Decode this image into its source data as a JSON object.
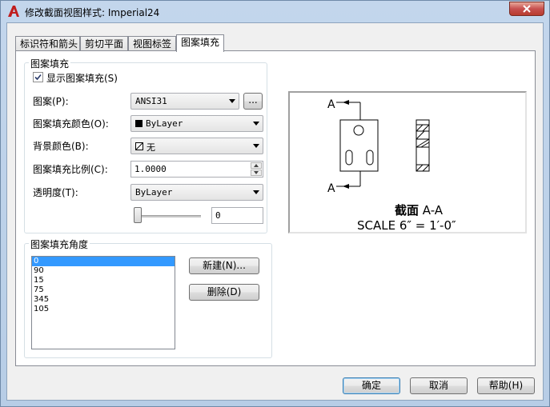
{
  "window": {
    "title": "修改截面视图样式: Imperial24"
  },
  "tabs": [
    {
      "label": "标识符和箭头"
    },
    {
      "label": "剪切平面"
    },
    {
      "label": "视图标签"
    },
    {
      "label": "图案填充"
    }
  ],
  "hatch_group": {
    "title": "图案填充",
    "show_hatch_label": "显示图案填充(S)",
    "show_hatch_checked": true,
    "pattern_label": "图案(P):",
    "pattern_value": "ANSI31",
    "browse_label": "...",
    "color_label": "图案填充颜色(O):",
    "color_value": "ByLayer",
    "bg_color_label": "背景颜色(B):",
    "bg_color_value": "无",
    "scale_label": "图案填充比例(C):",
    "scale_value": "1.0000",
    "transparency_label": "透明度(T):",
    "transparency_value": "ByLayer",
    "transparency_slider_value": "0"
  },
  "angle_group": {
    "title": "图案填充角度",
    "angles": [
      "0",
      "90",
      "15",
      "75",
      "345",
      "105"
    ],
    "selected_index": 0,
    "new_label": "新建(N)...",
    "delete_label": "删除(D)"
  },
  "preview": {
    "label_top": "A",
    "label_bottom": "A",
    "title_bold": "截面",
    "title_rest": " A-A",
    "scale_text": "SCALE 6″ = 1′-0″"
  },
  "footer": {
    "ok_label": "确定",
    "cancel_label": "取消",
    "help_label": "帮助(H)"
  },
  "colors": {
    "close_button": "#c75050",
    "selection": "#3399ff"
  }
}
